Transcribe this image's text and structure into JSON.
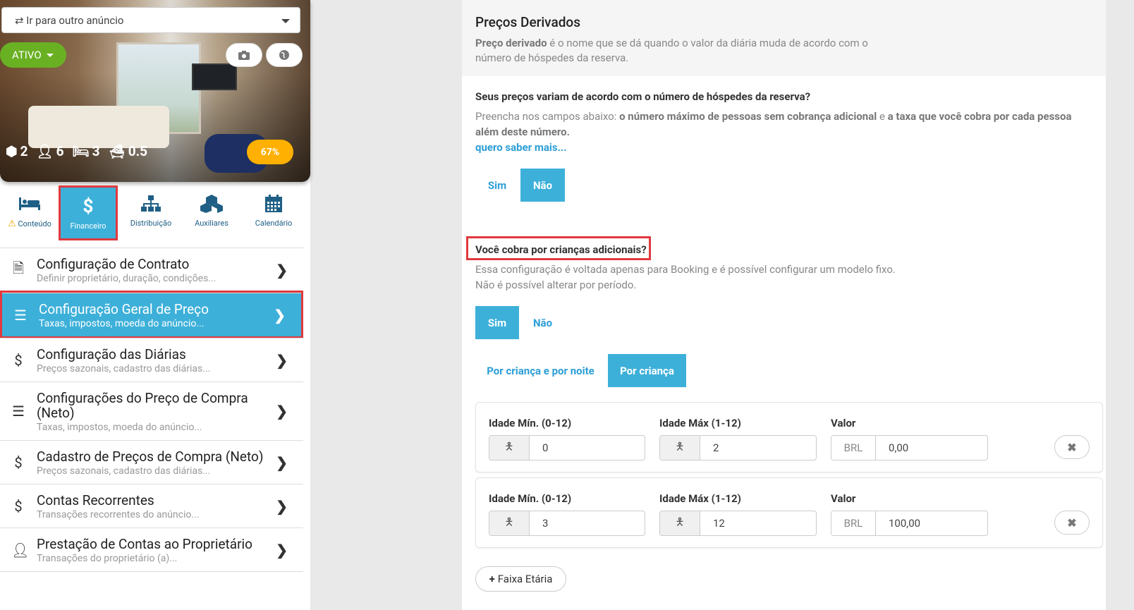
{
  "sidebar": {
    "goto_label": "⇄ Ir para outro anúncio",
    "status_label": "ATIVO",
    "stats": {
      "rooms": "2",
      "guests": "6",
      "beds": "3",
      "baths": "0.5"
    },
    "completion": "67%",
    "tabs": [
      {
        "label": "Conteúdo",
        "icon": "bed-icon",
        "warning": true
      },
      {
        "label": "Financeiro",
        "icon": "dollar-icon",
        "active": true
      },
      {
        "label": "Distribuição",
        "icon": "sitemap-icon"
      },
      {
        "label": "Auxiliares",
        "icon": "cubes-icon"
      },
      {
        "label": "Calendário",
        "icon": "calendar-icon"
      }
    ],
    "menu": [
      {
        "title": "Configuração de Contrato",
        "subtitle": "Definir proprietário, duração, condições..."
      },
      {
        "title": "Configuração Geral de Preço",
        "subtitle": "Taxas, impostos, moeda do anúncio...",
        "active": true
      },
      {
        "title": "Configuração das Diárias",
        "subtitle": "Preços sazonais, cadastro das diárias..."
      },
      {
        "title": "Configurações do Preço de Compra (Neto)",
        "subtitle": "Taxas, impostos, moeda do anúncio..."
      },
      {
        "title": "Cadastro de Preços de Compra (Neto)",
        "subtitle": "Preços sazonais, cadastro das diárias..."
      },
      {
        "title": "Contas Recorrentes",
        "subtitle": "Transações recorrentes do anúncio..."
      },
      {
        "title": "Prestação de Contas ao Proprietário",
        "subtitle": "Transações do proprietário (a)..."
      }
    ]
  },
  "main": {
    "title": "Preços Derivados",
    "intro_bold": "Preço derivado",
    "intro_rest": " é o nome que se dá quando o valor da diária muda de acordo com o número de hóspedes da reserva.",
    "q1": "Seus preços variam de acordo com o número de hóspedes da reserva?",
    "q1_desc_a": "Preencha nos campos abaixo: ",
    "q1_desc_b": "o número máximo de pessoas sem cobrança adicional",
    "q1_desc_c": " e ",
    "q1_desc_d": "a taxa que você cobra por cada pessoa além deste número.",
    "q1_link": "quero saber mais...",
    "q1_yes": "Sim",
    "q1_no": "Não",
    "q2": "Você cobra por crianças adicionais?",
    "q2_desc1": "Essa configuração é voltada apenas para Booking e é possível configurar um modelo fixo.",
    "q2_desc2": "Não é possível alterar por período.",
    "q2_yes": "Sim",
    "q2_no": "Não",
    "mode_a": "Por criança e por noite",
    "mode_b": "Por criança",
    "rows": [
      {
        "min_label": "Idade Mín. (0-12)",
        "min": "0",
        "max_label": "Idade Máx (1-12)",
        "max": "2",
        "val_label": "Valor",
        "currency": "BRL",
        "value": "0,00"
      },
      {
        "min_label": "Idade Mín. (0-12)",
        "min": "3",
        "max_label": "Idade Máx (1-12)",
        "max": "12",
        "val_label": "Valor",
        "currency": "BRL",
        "value": "100,00"
      }
    ],
    "add_label": "Faixa Etária"
  }
}
